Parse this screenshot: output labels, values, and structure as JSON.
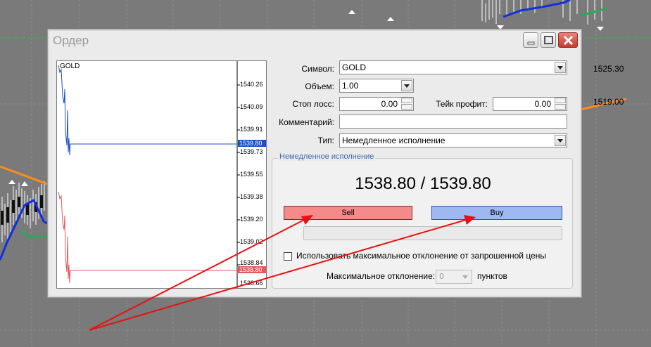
{
  "background": {
    "price_labels": [
      "1525.30",
      "1519.00"
    ]
  },
  "window": {
    "title": "Ордер",
    "controls": [
      "minimize",
      "maximize",
      "close"
    ]
  },
  "mini_chart": {
    "symbol": "GOLD",
    "scale": [
      "1540.26",
      "1540.09",
      "1539.91",
      "1539.73",
      "1539.55",
      "1539.38",
      "1539.20",
      "1539.02",
      "1538.84",
      "1538.66"
    ],
    "ask_tag": "1539.80",
    "bid_tag": "1538.80"
  },
  "form": {
    "symbol_label": "Символ:",
    "symbol_value": "GOLD",
    "volume_label": "Объем:",
    "volume_value": "1.00",
    "sl_label": "Стоп лосс:",
    "sl_value": "0.00",
    "tp_label": "Тейк профит:",
    "tp_value": "0.00",
    "comment_label": "Комментарий:",
    "comment_value": "",
    "type_label": "Тип:",
    "type_value": "Немедленное исполнение"
  },
  "execution": {
    "group_title": "Немедленное исполнение",
    "quote": "1538.80 / 1539.80",
    "sell_label": "Sell",
    "buy_label": "Buy",
    "max_dev_checkbox_label": "Использовать максимальное отклонение от запрошенной цены",
    "max_dev_label": "Максимальное отклонение:",
    "max_dev_value": "0",
    "points_label": "пунктов"
  },
  "colors": {
    "ask_line": "#1a4fc8",
    "bid_line": "#e45a5a",
    "annotation_arrow": "#e81010"
  }
}
